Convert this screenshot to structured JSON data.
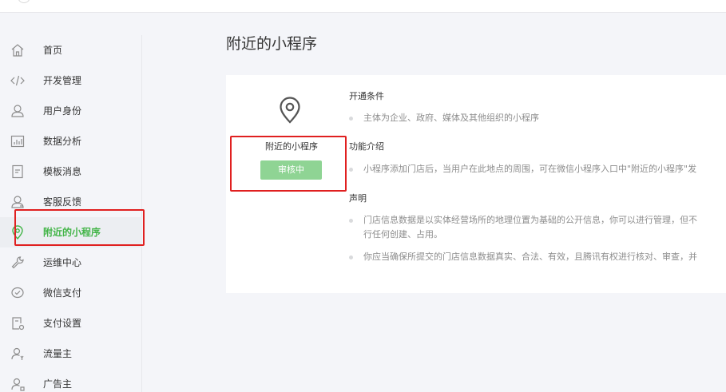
{
  "sidebar": {
    "items": [
      {
        "label": "首页",
        "icon": "home-icon"
      },
      {
        "label": "开发管理",
        "icon": "code-icon"
      },
      {
        "label": "用户身份",
        "icon": "user-icon"
      },
      {
        "label": "数据分析",
        "icon": "chart-icon"
      },
      {
        "label": "模板消息",
        "icon": "document-icon"
      },
      {
        "label": "客服反馈",
        "icon": "service-icon"
      },
      {
        "label": "附近的小程序",
        "icon": "location-icon",
        "active": true
      },
      {
        "label": "运维中心",
        "icon": "wrench-icon"
      },
      {
        "label": "微信支付",
        "icon": "wechat-pay-icon"
      },
      {
        "label": "支付设置",
        "icon": "payment-settings-icon"
      },
      {
        "label": "流量主",
        "icon": "traffic-owner-icon"
      },
      {
        "label": "广告主",
        "icon": "advertiser-icon"
      }
    ]
  },
  "main": {
    "title": "附近的小程序",
    "card": {
      "icon": "location-pin-icon",
      "name": "附近的小程序",
      "status": "审核中",
      "sections": [
        {
          "title": "开通条件",
          "bullets": [
            {
              "text": "主体为企业、政府、媒体及其他组织的小程序"
            }
          ]
        },
        {
          "title": "功能介绍",
          "bullets": [
            {
              "text": "小程序添加门店后，当用户在此地点的周围，可在微信小程序入口中\"附近的小程序\"发"
            }
          ]
        },
        {
          "title": "声明",
          "bullets": [
            {
              "text": "门店信息数据是以实体经营场所的地理位置为基础的公开信息，你可以进行管理，但不",
              "cont": "行任何创建、占用。"
            },
            {
              "text": "你应当确保所提交的门店信息数据真实、合法、有效，且腾讯有权进行核对、审查，并"
            }
          ]
        }
      ]
    }
  },
  "colors": {
    "accent": "#44b549",
    "status_button": "#8fd494",
    "highlight": "#e02020"
  }
}
